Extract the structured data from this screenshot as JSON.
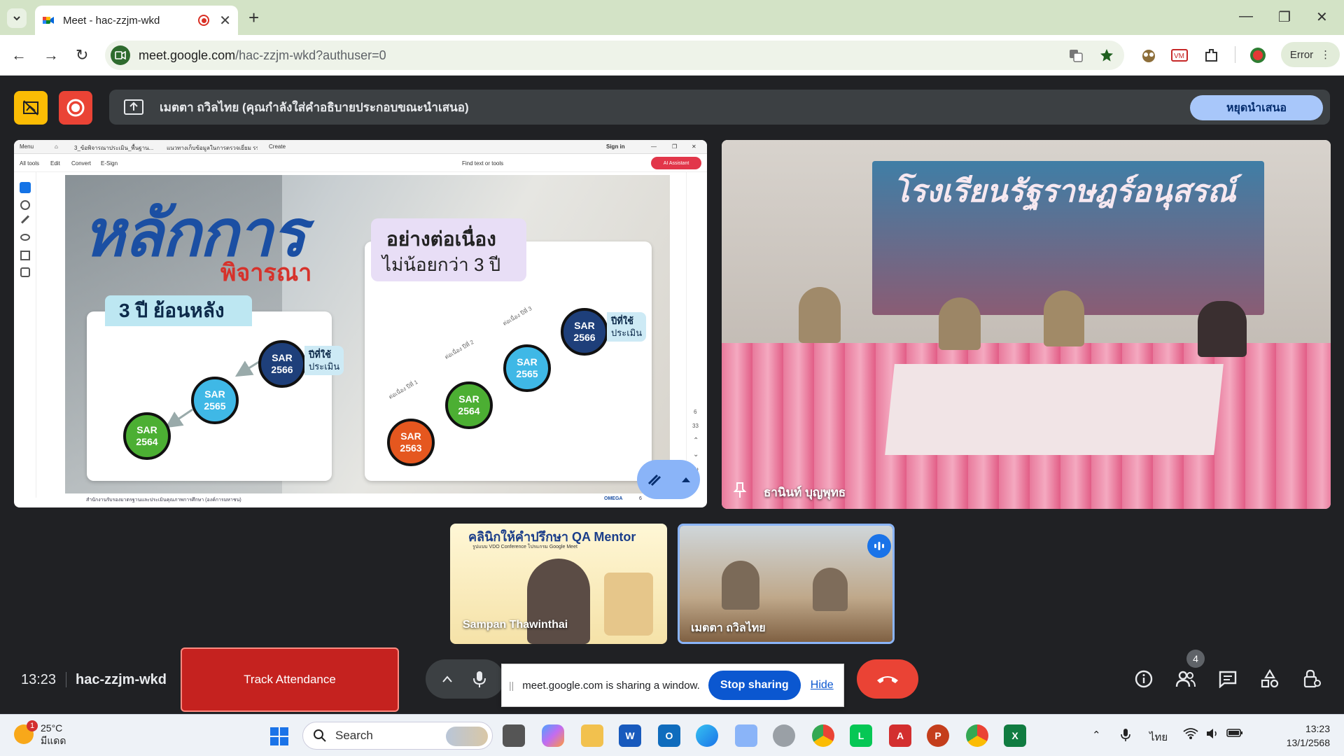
{
  "browser": {
    "tab_title": "Meet - hac-zzjm-wkd",
    "new_tab": "+",
    "url_domain": "meet.google.com",
    "url_path": "/hac-zzjm-wkd?authuser=0",
    "profile_status": "Error"
  },
  "meet": {
    "presenting_text": "เมตตา ถวิลไทย (คุณกำลังใส่คำอธิบายประกอบขณะนำเสนอ)",
    "stop_presenting_label": "หยุดนำเสนอ",
    "clock": "13:23",
    "meeting_code": "hac-zzjm-wkd",
    "track_attendance_label": "Track Attendance",
    "share_notice": "meet.google.com is sharing a window.",
    "stop_sharing_label": "Stop sharing",
    "hide_label": "Hide",
    "participant_count": "4",
    "participants": [
      {
        "name": "ธานินท์ บุญพุทธ"
      },
      {
        "name": "Sampan Thawinthai"
      },
      {
        "name": "เมตตา ถวิลไทย"
      }
    ],
    "cam_banner": "โรงเรียนรัฐราษฎร์อนุสรณ์",
    "mentor_banner_title": "คลินิกให้คำปรึกษา QA Mentor",
    "mentor_banner_sub": "รูปแบบ VDO Conference โปรแกรม Google Meet",
    "colors": {
      "accent": "#a8c7fa",
      "hangup": "#ea4335",
      "track": "#c5221f"
    }
  },
  "acrobat": {
    "menu": "Menu",
    "tab1": "3_ข้อพิจารณาประเมิน_พื้นฐาน...",
    "tab2": "แนวทางเก็บข้อมูลในการตรวจเยี่ยม รร ร์...",
    "create": "Create",
    "sign_in": "Sign in",
    "all_tools": "All tools",
    "edit": "Edit",
    "convert": "Convert",
    "esign": "E-Sign",
    "find": "Find text or tools",
    "ai_assistant": "AI Assistant",
    "page_num": "6",
    "page_total": "33",
    "footer_left": "สำนักงานรับรองมาตรฐานและประเมินคุณภาพการศึกษา (องค์การมหาชน)",
    "footer_right": "OMEGA",
    "footer_page": "6"
  },
  "slide": {
    "title": "หลักการ",
    "subtitle": "พิจารณา",
    "left_label": "3 ปี ย้อนหลัง",
    "right_label_1": "อย่างต่อเนื่อง",
    "right_label_2": "ไม่น้อยกว่า 3 ปี",
    "use_tag_1": "ปีที่ใช้",
    "use_tag_2": "ประเมิน",
    "left_circles": [
      {
        "sar": "SAR",
        "year": "2566"
      },
      {
        "sar": "SAR",
        "year": "2565"
      },
      {
        "sar": "SAR",
        "year": "2564"
      }
    ],
    "right_circles": [
      {
        "sar": "SAR",
        "year": "2563"
      },
      {
        "sar": "SAR",
        "year": "2564"
      },
      {
        "sar": "SAR",
        "year": "2565"
      },
      {
        "sar": "SAR",
        "year": "2566"
      }
    ],
    "steps": [
      "ต่อเนื่อง ปีที่ 1",
      "ต่อเนื่อง ปีที่ 2",
      "ต่อเนื่อง ปีที่ 3"
    ]
  },
  "taskbar": {
    "temp": "25°C",
    "weather_desc": "มีแดด",
    "weather_alert": "1",
    "search": "Search",
    "lang": "ไทย",
    "time": "13:23",
    "date": "13/1/2568"
  }
}
